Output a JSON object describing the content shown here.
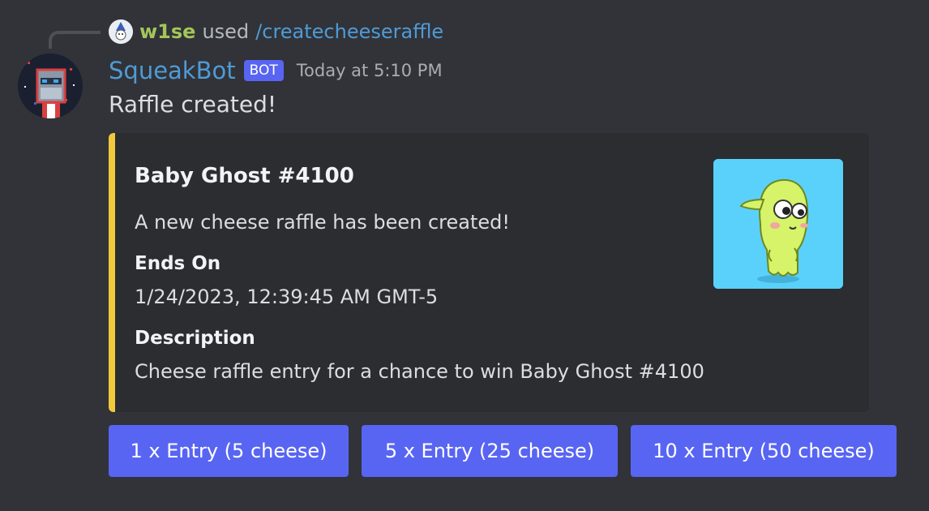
{
  "reply": {
    "username": "w1se",
    "used_text": "used",
    "command": "/createcheeseraffle"
  },
  "message": {
    "author": "SqueakBot",
    "badge": "BOT",
    "timestamp": "Today at 5:10 PM",
    "content": "Raffle created!"
  },
  "embed": {
    "accent_color": "#f0c93c",
    "title": "Baby Ghost #4100",
    "description": "A new cheese raffle has been created!",
    "fields": [
      {
        "name": "Ends On",
        "value": "1/24/2023, 12:39:45 AM GMT-5"
      },
      {
        "name": "Description",
        "value": "Cheese raffle entry for a chance to win Baby Ghost #4100"
      }
    ]
  },
  "buttons": [
    {
      "label": "1 x Entry (5 cheese)"
    },
    {
      "label": "5 x Entry (25 cheese)"
    },
    {
      "label": "10 x Entry (50 cheese)"
    }
  ],
  "colors": {
    "background": "#313338",
    "embed_bg": "#2b2d31",
    "button": "#5865f2",
    "username": "#4f9bd6",
    "reply_username": "#a4c55a"
  }
}
